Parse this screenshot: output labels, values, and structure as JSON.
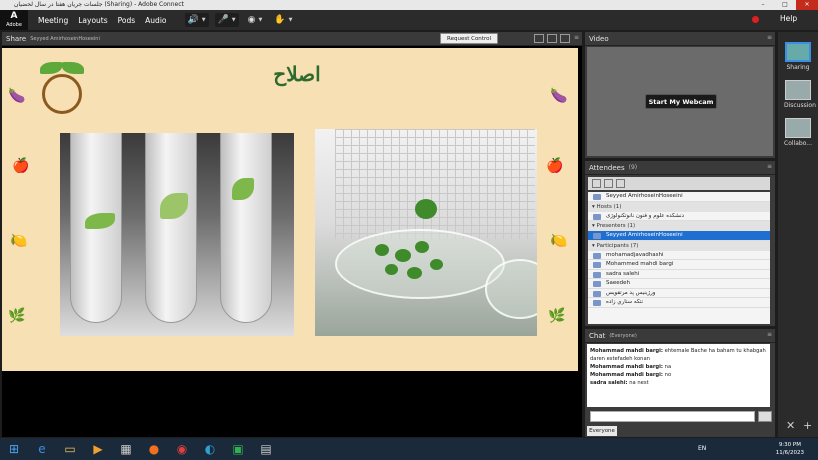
{
  "window": {
    "title": "جلسات جريان هفتا در سال لحضيان (Sharing) - Adobe Connect"
  },
  "menu": {
    "items": [
      "Meeting",
      "Layouts",
      "Pods",
      "Audio"
    ],
    "help": "Help",
    "logo": "Adobe"
  },
  "share_pod": {
    "title": "Share",
    "presenter": "Seyyed AmirhoseinHoseeini",
    "request_control": "Request Control"
  },
  "slide": {
    "title": "اصلاح"
  },
  "video_pod": {
    "title": "Video",
    "start_webcam": "Start My Webcam"
  },
  "attendees": {
    "title": "Attendees",
    "count": "(9)",
    "me": "Seyyed AmirhoseinHoseeini",
    "hosts_label": "Hosts (1)",
    "hosts": [
      "دنشكده علوم و فنون نانوتكنولوژی"
    ],
    "presenters_label": "Presenters (1)",
    "presenters": [
      "Seyyed AmirhoseinHoseeini"
    ],
    "participants_label": "Participants (7)",
    "participants": [
      "mohamadjavadhashi",
      "Mohammed mahdi bargi",
      "sadra salehi",
      "Saeedeh",
      "ورژینیس پد مرتقویس",
      "نتكه ستاري زاده"
    ]
  },
  "chat": {
    "title": "Chat",
    "scope": "(Everyone)",
    "messages": [
      {
        "name": "Mohammad mahdi bargi:",
        "text": "ehtemale Bache ha baham tu khabgah daren estefadeh konan"
      },
      {
        "name": "Mohammad mahdi bargi:",
        "text": "na"
      },
      {
        "name": "Mohammad mahdi bargi:",
        "text": "no"
      },
      {
        "name": "sadra salehi:",
        "text": "na nest"
      }
    ],
    "tab": "Everyone"
  },
  "layouts": [
    "Sharing",
    "Discussion",
    "Collabo..."
  ],
  "taskbar": {
    "lang": "EN",
    "time": "9:30 PM",
    "date": "11/6/2023"
  }
}
